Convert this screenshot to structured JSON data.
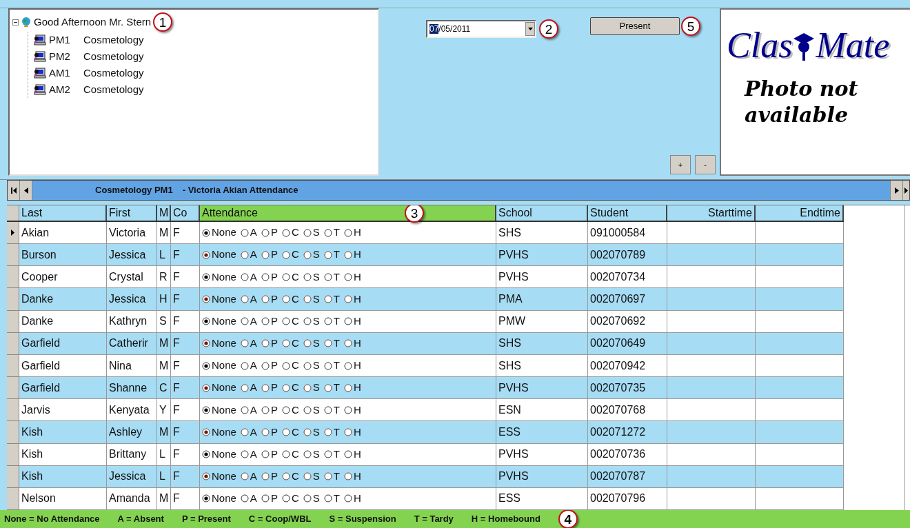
{
  "tree": {
    "label": "Good Afternoon Mr. Stern",
    "expanded": true,
    "children": [
      {
        "code": "PM1",
        "name": "Cosmetology"
      },
      {
        "code": "PM2",
        "name": "Cosmetology"
      },
      {
        "code": "AM1",
        "name": "Cosmetology"
      },
      {
        "code": "AM2",
        "name": "Cosmetology"
      }
    ]
  },
  "date_field": {
    "selected_part": "07",
    "rest": "/05/2011"
  },
  "present_button": "Present",
  "zoom_buttons": [
    "+",
    "-"
  ],
  "photo_panel": {
    "logo_left": "Clas",
    "logo_right": "Mate",
    "message": "Photo not available"
  },
  "nav_bar": {
    "course": "Cosmetology PM1",
    "subtitle": "- Victoria Akian Attendance"
  },
  "table": {
    "columns": [
      "Last",
      "First",
      "M",
      "Co",
      "Attendance",
      "School",
      "Student",
      "Starttime",
      "Endtime"
    ],
    "rows": [
      {
        "current": true,
        "last": "Akian",
        "first": "Victoria",
        "m": "M",
        "co": "F",
        "options": [
          {
            "label": "None",
            "selected": true
          },
          {
            "label": "A",
            "selected": false
          },
          {
            "label": "P",
            "selected": false
          },
          {
            "label": "C",
            "selected": false
          },
          {
            "label": "S",
            "selected": false
          },
          {
            "label": "T",
            "selected": false
          },
          {
            "label": "H",
            "selected": false
          }
        ],
        "school": "SHS",
        "student": "091000584"
      },
      {
        "current": false,
        "last": "Burson",
        "first": "Jessica",
        "m": "L",
        "co": "F",
        "options": [
          {
            "label": "None",
            "selected": true
          },
          {
            "label": "A",
            "selected": false
          },
          {
            "label": "P",
            "selected": false
          },
          {
            "label": "C",
            "selected": false
          },
          {
            "label": "S",
            "selected": false
          },
          {
            "label": "T",
            "selected": false
          },
          {
            "label": "H",
            "selected": false
          }
        ],
        "school": "PVHS",
        "student": "002070789"
      },
      {
        "current": false,
        "last": "Cooper",
        "first": "Crystal",
        "m": "R",
        "co": "F",
        "options": [
          {
            "label": "None",
            "selected": true
          },
          {
            "label": "A",
            "selected": false
          },
          {
            "label": "P",
            "selected": false
          },
          {
            "label": "C",
            "selected": false
          },
          {
            "label": "S",
            "selected": false
          },
          {
            "label": "T",
            "selected": false
          },
          {
            "label": "H",
            "selected": false
          }
        ],
        "school": "PVHS",
        "student": "002070734"
      },
      {
        "current": false,
        "last": "Danke",
        "first": "Jessica",
        "m": "H",
        "co": "F",
        "options": [
          {
            "label": "None",
            "selected": true
          },
          {
            "label": "A",
            "selected": false
          },
          {
            "label": "P",
            "selected": false
          },
          {
            "label": "C",
            "selected": false
          },
          {
            "label": "S",
            "selected": false
          },
          {
            "label": "T",
            "selected": false
          },
          {
            "label": "H",
            "selected": false
          }
        ],
        "school": "PMA",
        "student": "002070697"
      },
      {
        "current": false,
        "last": "Danke",
        "first": "Kathryn",
        "m": "S",
        "co": "F",
        "options": [
          {
            "label": "None",
            "selected": true
          },
          {
            "label": "A",
            "selected": false
          },
          {
            "label": "P",
            "selected": false
          },
          {
            "label": "C",
            "selected": false
          },
          {
            "label": "S",
            "selected": false
          },
          {
            "label": "T",
            "selected": false
          },
          {
            "label": "H",
            "selected": false
          }
        ],
        "school": "PMW",
        "student": "002070692"
      },
      {
        "current": false,
        "last": "Garfield",
        "first": "Catherir",
        "m": "M",
        "co": "F",
        "options": [
          {
            "label": "None",
            "selected": true
          },
          {
            "label": "A",
            "selected": false
          },
          {
            "label": "P",
            "selected": false
          },
          {
            "label": "C",
            "selected": false
          },
          {
            "label": "S",
            "selected": false
          },
          {
            "label": "T",
            "selected": false
          },
          {
            "label": "H",
            "selected": false
          }
        ],
        "school": "SHS",
        "student": "002070649"
      },
      {
        "current": false,
        "last": "Garfield",
        "first": "Nina",
        "m": "M",
        "co": "F",
        "options": [
          {
            "label": "None",
            "selected": true
          },
          {
            "label": "A",
            "selected": false
          },
          {
            "label": "P",
            "selected": false
          },
          {
            "label": "C",
            "selected": false
          },
          {
            "label": "S",
            "selected": false
          },
          {
            "label": "T",
            "selected": false
          },
          {
            "label": "H",
            "selected": false
          }
        ],
        "school": "SHS",
        "student": "002070942"
      },
      {
        "current": false,
        "last": "Garfield",
        "first": "Shanne",
        "m": "C",
        "co": "F",
        "options": [
          {
            "label": "None",
            "selected": true
          },
          {
            "label": "A",
            "selected": false
          },
          {
            "label": "P",
            "selected": false
          },
          {
            "label": "C",
            "selected": false
          },
          {
            "label": "S",
            "selected": false
          },
          {
            "label": "T",
            "selected": false
          },
          {
            "label": "H",
            "selected": false
          }
        ],
        "school": "PVHS",
        "student": "002070735"
      },
      {
        "current": false,
        "last": "Jarvis",
        "first": "Kenyata",
        "m": "Y",
        "co": "F",
        "options": [
          {
            "label": "None",
            "selected": true
          },
          {
            "label": "A",
            "selected": false
          },
          {
            "label": "P",
            "selected": false
          },
          {
            "label": "C",
            "selected": false
          },
          {
            "label": "S",
            "selected": false
          },
          {
            "label": "T",
            "selected": false
          },
          {
            "label": "H",
            "selected": false
          }
        ],
        "school": "ESN",
        "student": "002070768"
      },
      {
        "current": false,
        "last": "Kish",
        "first": "Ashley",
        "m": "M",
        "co": "F",
        "options": [
          {
            "label": "None",
            "selected": true
          },
          {
            "label": "A",
            "selected": false
          },
          {
            "label": "P",
            "selected": false
          },
          {
            "label": "C",
            "selected": false
          },
          {
            "label": "S",
            "selected": false
          },
          {
            "label": "T",
            "selected": false
          },
          {
            "label": "H",
            "selected": false
          }
        ],
        "school": "ESS",
        "student": "002071272"
      },
      {
        "current": false,
        "last": "Kish",
        "first": "Brittany",
        "m": "L",
        "co": "F",
        "options": [
          {
            "label": "None",
            "selected": true
          },
          {
            "label": "A",
            "selected": false
          },
          {
            "label": "P",
            "selected": false
          },
          {
            "label": "C",
            "selected": false
          },
          {
            "label": "S",
            "selected": false
          },
          {
            "label": "T",
            "selected": false
          },
          {
            "label": "H",
            "selected": false
          }
        ],
        "school": "PVHS",
        "student": "002070736"
      },
      {
        "current": false,
        "last": "Kish",
        "first": "Jessica",
        "m": "L",
        "co": "F",
        "options": [
          {
            "label": "None",
            "selected": true
          },
          {
            "label": "A",
            "selected": false
          },
          {
            "label": "P",
            "selected": false
          },
          {
            "label": "C",
            "selected": false
          },
          {
            "label": "S",
            "selected": false
          },
          {
            "label": "T",
            "selected": false
          },
          {
            "label": "H",
            "selected": false
          }
        ],
        "school": "PVHS",
        "student": "002070787"
      },
      {
        "current": false,
        "last": "Nelson",
        "first": "Amanda",
        "m": "M",
        "co": "F",
        "options": [
          {
            "label": "None",
            "selected": true
          },
          {
            "label": "A",
            "selected": false
          },
          {
            "label": "P",
            "selected": false
          },
          {
            "label": "C",
            "selected": false
          },
          {
            "label": "S",
            "selected": false
          },
          {
            "label": "T",
            "selected": false
          },
          {
            "label": "H",
            "selected": false
          }
        ],
        "school": "ESS",
        "student": "002070796"
      }
    ]
  },
  "legend": [
    "None = No Attendance",
    "A = Absent",
    "P = Present",
    "C = Coop/WBL",
    "S = Suspension",
    "T = Tardy",
    "H = Homebound"
  ],
  "callouts": [
    "1",
    "2",
    "3",
    "4",
    "5"
  ]
}
